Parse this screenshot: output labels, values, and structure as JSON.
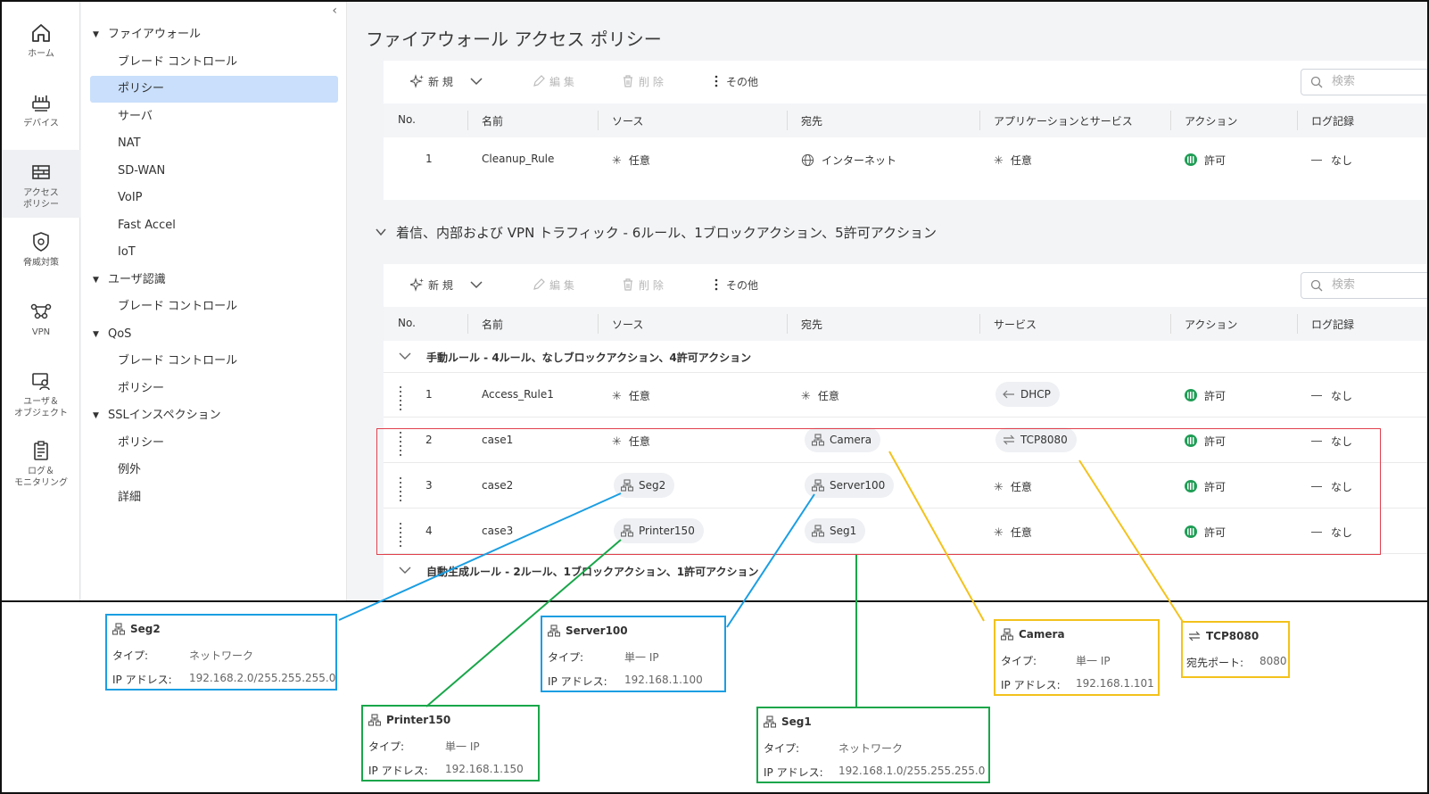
{
  "rail": [
    {
      "label": "ホーム",
      "icon": "home-icon"
    },
    {
      "label": "デバイス",
      "icon": "device-icon"
    },
    {
      "label": "アクセス\nポリシー",
      "icon": "firewall-icon"
    },
    {
      "label": "脅威対策",
      "icon": "shield-icon"
    },
    {
      "label": "VPN",
      "icon": "vpn-icon"
    },
    {
      "label": "ユーザ＆\nオブジェクト",
      "icon": "user-object-icon"
    },
    {
      "label": "ログ＆\nモニタリング",
      "icon": "clipboard-icon"
    }
  ],
  "nav": {
    "collapse": "‹",
    "items": [
      {
        "label": "ファイアウォール",
        "kind": "group"
      },
      {
        "label": "ブレード コントロール",
        "kind": "sub"
      },
      {
        "label": "ポリシー",
        "kind": "sub",
        "selected": true
      },
      {
        "label": "サーバ",
        "kind": "sub"
      },
      {
        "label": "NAT",
        "kind": "sub"
      },
      {
        "label": "SD-WAN",
        "kind": "sub"
      },
      {
        "label": "VoIP",
        "kind": "sub"
      },
      {
        "label": "Fast Accel",
        "kind": "sub"
      },
      {
        "label": "IoT",
        "kind": "sub"
      },
      {
        "label": "ユーザ認識",
        "kind": "group"
      },
      {
        "label": "ブレード コントロール",
        "kind": "sub"
      },
      {
        "label": "QoS",
        "kind": "group"
      },
      {
        "label": "ブレード コントロール",
        "kind": "sub"
      },
      {
        "label": "ポリシー",
        "kind": "sub"
      },
      {
        "label": "SSLインスペクション",
        "kind": "group"
      },
      {
        "label": "ポリシー",
        "kind": "sub"
      },
      {
        "label": "例外",
        "kind": "sub"
      },
      {
        "label": "詳細",
        "kind": "sub"
      }
    ]
  },
  "page": {
    "title": "ファイアウォール アクセス ポリシー"
  },
  "toolbar": {
    "new": "新 規",
    "edit": "編 集",
    "delete": "削 除",
    "more": "その他",
    "search_placeholder": "検索"
  },
  "table1": {
    "headers": [
      "No.",
      "名前",
      "ソース",
      "宛先",
      "アプリケーションとサービス",
      "アクション",
      "ログ記録"
    ],
    "row": {
      "no": "1",
      "name": "Cleanup_Rule",
      "source": "任意",
      "dest": "インターネット",
      "service": "任意",
      "action": "許可",
      "log": "なし"
    }
  },
  "section": {
    "title": "着信、内部および VPN トラフィック - 6ルール、1ブロックアクション、5許可アクション"
  },
  "table2": {
    "headers": [
      "No.",
      "名前",
      "ソース",
      "宛先",
      "サービス",
      "アクション",
      "ログ記録"
    ],
    "manual_group": "手動ルール - 4ルール、なしブロックアクション、4許可アクション",
    "auto_group": "自動生成ルール - 2ルール、1ブロックアクション、1許可アクション",
    "rows": [
      {
        "no": "1",
        "name": "Access_Rule1",
        "source": "任意",
        "dest": "任意",
        "service": "DHCP",
        "action": "許可",
        "log": "なし"
      },
      {
        "no": "2",
        "name": "case1",
        "source": "任意",
        "dest": "Camera",
        "service": "TCP8080",
        "action": "許可",
        "log": "なし"
      },
      {
        "no": "3",
        "name": "case2",
        "source": "Seg2",
        "dest": "Server100",
        "service": "任意",
        "action": "許可",
        "log": "なし"
      },
      {
        "no": "4",
        "name": "case3",
        "source": "Printer150",
        "dest": "Seg1",
        "service": "任意",
        "action": "許可",
        "log": "なし"
      }
    ]
  },
  "callouts": {
    "seg2": {
      "title": "Seg2",
      "k1": "タイプ:",
      "v1": "ネットワーク",
      "k2": "IP アドレス:",
      "v2": "192.168.2.0/255.255.255.0"
    },
    "printer150": {
      "title": "Printer150",
      "k1": "タイプ:",
      "v1": "単一 IP",
      "k2": "IP アドレス:",
      "v2": "192.168.1.150"
    },
    "server100": {
      "title": "Server100",
      "k1": "タイプ:",
      "v1": "単一 IP",
      "k2": "IP アドレス:",
      "v2": "192.168.1.100"
    },
    "seg1": {
      "title": "Seg1",
      "k1": "タイプ:",
      "v1": "ネットワーク",
      "k2": "IP アドレス:",
      "v2": "192.168.1.0/255.255.255.0"
    },
    "camera": {
      "title": "Camera",
      "k1": "タイプ:",
      "v1": "単一 IP",
      "k2": "IP アドレス:",
      "v2": "192.168.1.101"
    },
    "tcp8080": {
      "title": "TCP8080",
      "k1": "宛先ポート:",
      "v1": "8080"
    }
  },
  "colors": {
    "blue": "#1b9ee2",
    "green": "#19a64a",
    "yellow": "#f3c21c",
    "red": "#e0404c",
    "selected": "#c9dffb",
    "allow": "#1f9d55"
  }
}
